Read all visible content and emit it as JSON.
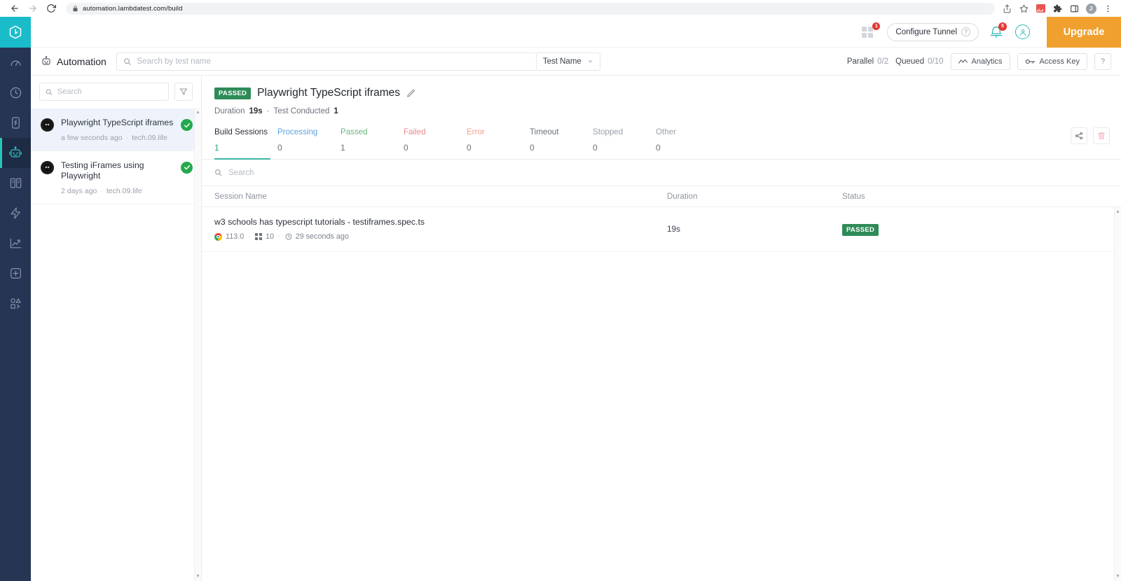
{
  "browser": {
    "url": "automation.lambdatest.com/build",
    "back_icon": "back-arrow-icon",
    "forward_icon": "forward-arrow-icon",
    "reload_icon": "reload-icon",
    "lock_icon": "lock-icon",
    "share_icon": "share-icon",
    "bookmark_icon": "star-icon",
    "extension_icon": "puzzle-icon",
    "sidepanel_icon": "side-panel-icon",
    "profile_initial": "J",
    "menu_icon": "kebab-menu-icon"
  },
  "rail": {
    "logo": "lambdatest-logo",
    "items": [
      {
        "name": "sidebar-item-dashboard",
        "icon": "speedometer-icon",
        "active": false
      },
      {
        "name": "sidebar-item-realtime",
        "icon": "clock-icon",
        "active": false
      },
      {
        "name": "sidebar-item-app-testing",
        "icon": "mobile-device-icon",
        "active": false
      },
      {
        "name": "sidebar-item-automation",
        "icon": "robot-icon",
        "active": true
      },
      {
        "name": "sidebar-item-visual-regression",
        "icon": "compare-pages-icon",
        "active": false
      },
      {
        "name": "sidebar-item-smart-testing",
        "icon": "lightning-bolt-icon",
        "active": false
      },
      {
        "name": "sidebar-item-analytics",
        "icon": "trend-chart-icon",
        "active": false
      },
      {
        "name": "sidebar-item-integrations",
        "icon": "plus-square-icon",
        "active": false
      },
      {
        "name": "sidebar-item-developer",
        "icon": "shapes-code-icon",
        "active": false
      }
    ]
  },
  "topbar": {
    "grid_badge": "1",
    "configure_tunnel_label": "Configure Tunnel",
    "tunnel_help": "?",
    "bell_badge": "5",
    "upgrade_label": "Upgrade"
  },
  "subbar": {
    "product_title": "Automation",
    "product_icon": "robot-icon",
    "search_placeholder": "Search by test name",
    "search_value": "",
    "filter_select_value": "Test Name",
    "parallel_label": "Parallel",
    "parallel_value": "0/2",
    "queued_label": "Queued",
    "queued_value": "0/10",
    "analytics_label": "Analytics",
    "access_key_label": "Access Key",
    "help_label": "?"
  },
  "builds_panel": {
    "search_placeholder": "Search",
    "search_value": "",
    "filter_icon": "filter-funnel-icon",
    "items": [
      {
        "name": "Playwright TypeScript iframes",
        "time": "a few seconds ago",
        "user": "tech.09.life",
        "status": "passed",
        "selected": true
      },
      {
        "name": "Testing iFrames using Playwright",
        "time": "2 days ago",
        "user": "tech.09.life",
        "status": "passed",
        "selected": false
      }
    ]
  },
  "detail": {
    "status_badge": "PASSED",
    "title": "Playwright TypeScript iframes",
    "edit_icon": "pencil-edit-icon",
    "duration_label": "Duration",
    "duration_value": "19s",
    "meta_separator": "·",
    "tests_label": "Test Conducted",
    "tests_value": "1",
    "tabs": [
      {
        "label": "Build Sessions",
        "value": "1",
        "active": true,
        "label_color": "#2b3039",
        "value_color": "#2fa37c"
      },
      {
        "label": "Processing",
        "value": "0",
        "active": false,
        "label_color": "#5ba3e0",
        "value_color": "#6b7079"
      },
      {
        "label": "Passed",
        "value": "1",
        "active": false,
        "label_color": "#68b37e",
        "value_color": "#6b7079"
      },
      {
        "label": "Failed",
        "value": "0",
        "active": false,
        "label_color": "#e98a8a",
        "value_color": "#6b7079"
      },
      {
        "label": "Error",
        "value": "0",
        "active": false,
        "label_color": "#f0a08f",
        "value_color": "#6b7079"
      },
      {
        "label": "Timeout",
        "value": "0",
        "active": false,
        "label_color": "#6b7079",
        "value_color": "#6b7079"
      },
      {
        "label": "Stopped",
        "value": "0",
        "active": false,
        "label_color": "#9aa0aa",
        "value_color": "#6b7079"
      },
      {
        "label": "Other",
        "value": "0",
        "active": false,
        "label_color": "#9aa0aa",
        "value_color": "#6b7079"
      }
    ],
    "share_icon": "share-node-icon",
    "delete_icon": "trash-delete-icon",
    "session_search_placeholder": "Search",
    "session_search_value": "",
    "columns": {
      "session_name": "Session Name",
      "duration": "Duration",
      "status": "Status"
    },
    "sessions": [
      {
        "name": "w3 schools has typescript tutorials - testiframes.spec.ts",
        "browser_icon": "chrome-icon",
        "browser_version": "113.0",
        "os_icon": "windows-icon",
        "os_version": "10",
        "time_icon": "clock-icon",
        "time": "29 seconds ago",
        "duration": "19s",
        "status": "PASSED"
      }
    ]
  },
  "colors": {
    "brand_teal": "#1bbcc9",
    "rail_bg": "#263553",
    "accent_green": "#2e8b57",
    "upgrade_orange": "#f0a02e",
    "badge_red": "#e53935",
    "tab_underline": "#3ab5a0",
    "selected_row": "#eef2fb"
  }
}
